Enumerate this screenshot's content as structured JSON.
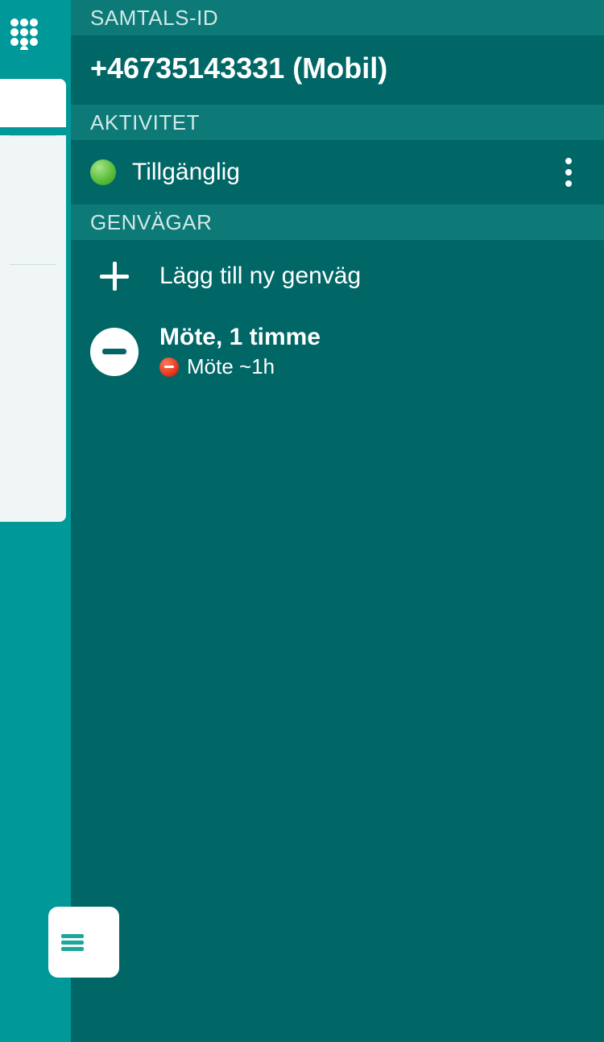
{
  "sections": {
    "caller_id_header": "SAMTALS-ID",
    "caller_id_value": "+46735143331 (Mobil)",
    "activity_header": "AKTIVITET",
    "activity_status_label": "Tillgänglig",
    "shortcuts_header": "GENVÄGAR"
  },
  "shortcuts": {
    "add_label": "Lägg till ny genväg",
    "items": [
      {
        "title": "Möte, 1 timme",
        "subtitle": "Möte ~1h"
      }
    ]
  },
  "icons": {
    "dialpad": "dialpad-icon",
    "more": "more-vertical-icon",
    "plus": "plus-icon",
    "minus": "minus-icon",
    "menu": "menu-icon",
    "status_available": "status-available-dot",
    "status_busy_badge": "no-entry-icon"
  },
  "colors": {
    "sidebar": "#009898",
    "main_bg": "#006666",
    "header_bg": "#0e7a77",
    "available_green": "#5cbf3c",
    "busy_red": "#e53a1e"
  }
}
